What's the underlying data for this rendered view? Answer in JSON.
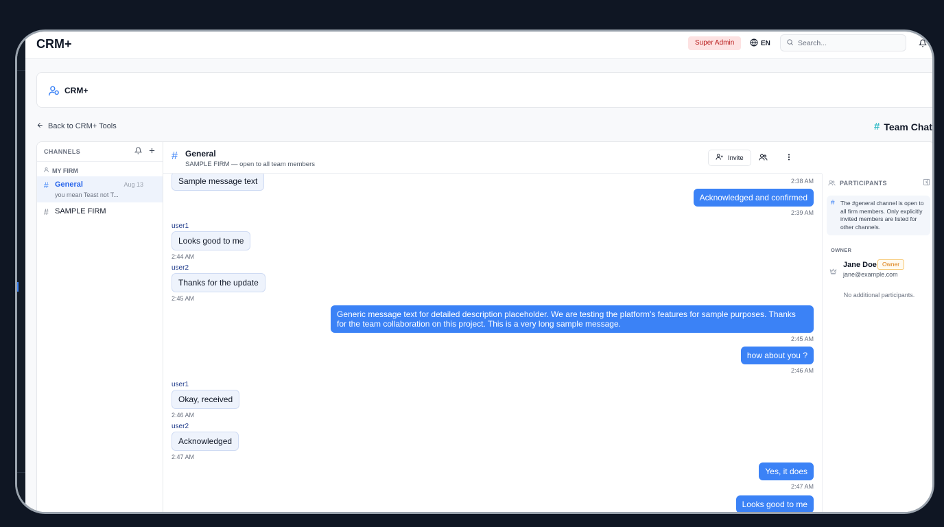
{
  "app": {
    "brand": "CRM+",
    "role_badge": "Super Admin",
    "language": "EN",
    "search_placeholder": "Search..."
  },
  "page": {
    "title": "CRM+",
    "back_link": "Back to CRM+ Tools",
    "section_title": "Team Chat"
  },
  "sidebar": {
    "header": "CHANNELS",
    "group": "MY FIRM",
    "channels": [
      {
        "name": "General",
        "date": "Aug 13",
        "preview": "you mean Teast not T..."
      },
      {
        "name": "SAMPLE FIRM"
      }
    ]
  },
  "conversation": {
    "title": "General",
    "subtitle": "SAMPLE FIRM — open to all team members",
    "invite_label": "Invite",
    "messages": [
      {
        "dir": "in",
        "text": "Sample message text",
        "time": "2:38 AM"
      },
      {
        "dir": "out",
        "text": "Acknowledged and confirmed",
        "time": "2:39 AM"
      },
      {
        "dir": "in",
        "sender": "user1",
        "text": "Looks good to me",
        "time": "2:44 AM"
      },
      {
        "dir": "in",
        "sender": "user2",
        "text": "Thanks for the update",
        "time": "2:45 AM"
      },
      {
        "dir": "out",
        "text": "Generic message text for detailed description placeholder. We are testing the platform's features for sample purposes. Thanks for the team collaboration on this project. This is a very long sample message.",
        "time": "2:45 AM"
      },
      {
        "dir": "out",
        "text": "how about you ?",
        "time": "2:46 AM"
      },
      {
        "dir": "in",
        "sender": "user1",
        "text": "Okay, received",
        "time": "2:46 AM"
      },
      {
        "dir": "in",
        "sender": "user2",
        "text": "Acknowledged",
        "time": "2:47 AM"
      },
      {
        "dir": "out",
        "text": "Yes, it does",
        "time": "2:47 AM"
      },
      {
        "dir": "out",
        "text": "Looks good to me"
      }
    ]
  },
  "participants": {
    "header": "PARTICIPANTS",
    "info": "The #general channel is open to all firm members. Only explicitly invited members are listed for other channels.",
    "owner_label": "OWNER",
    "owner": {
      "name": "Jane Doe",
      "tag": "Owner",
      "email": "jane@example.com"
    },
    "empty_text": "No additional participants."
  },
  "colors": {
    "accent": "#3b82f6",
    "badge_bg": "#fde2e2",
    "owner_tag": "#d97706"
  }
}
